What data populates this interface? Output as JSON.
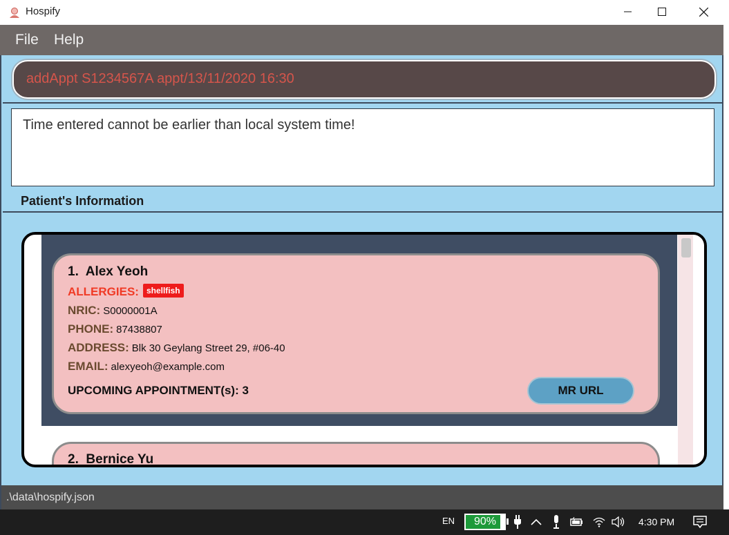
{
  "window": {
    "title": "Hospify",
    "icons": {
      "app": "hospify-logo-icon",
      "minimize": "minimize-icon",
      "maximize": "maximize-icon",
      "close": "close-icon"
    }
  },
  "menu": {
    "file": "File",
    "help": "Help"
  },
  "command": {
    "value": "addAppt S1234567A appt/13/11/2020 16:30"
  },
  "result": {
    "message": "Time entered cannot be earlier than local system time!"
  },
  "panel": {
    "title": "Patient's Information"
  },
  "patients": [
    {
      "index": "1.",
      "name": "Alex Yeoh",
      "allergies_label": "ALLERGIES:",
      "allergies": [
        "shellfish"
      ],
      "nric_label": "NRIC:",
      "nric": "S0000001A",
      "phone_label": "PHONE:",
      "phone": "87438807",
      "address_label": "ADDRESS:",
      "address": "Blk 30 Geylang Street 29, #06-40",
      "email_label": "EMAIL:",
      "email": "alexyeoh@example.com",
      "upcoming": "UPCOMING APPOINTMENT(s): 3",
      "mr_button": "MR URL"
    },
    {
      "index": "2.",
      "name": "Bernice Yu"
    }
  ],
  "status": {
    "path": ".\\data\\hospify.json"
  },
  "taskbar": {
    "language": "EN",
    "battery_level": 0.9,
    "battery": "90%",
    "time": "4:30 PM",
    "icons": [
      "power-plug-icon",
      "chevron-up-icon",
      "microphone-icon",
      "battery-charging-icon",
      "wifi-icon",
      "speaker-icon",
      "notification-icon"
    ]
  },
  "colors": {
    "background": "#a2d6f0",
    "menubar": "#6e6866",
    "command_box": "#574848",
    "command_text": "#d5554b",
    "card": "#f3c0c1",
    "allergy_tag": "#ee1c1c",
    "mr_button": "#5da1c5",
    "list_inner": "#3f4d63"
  }
}
